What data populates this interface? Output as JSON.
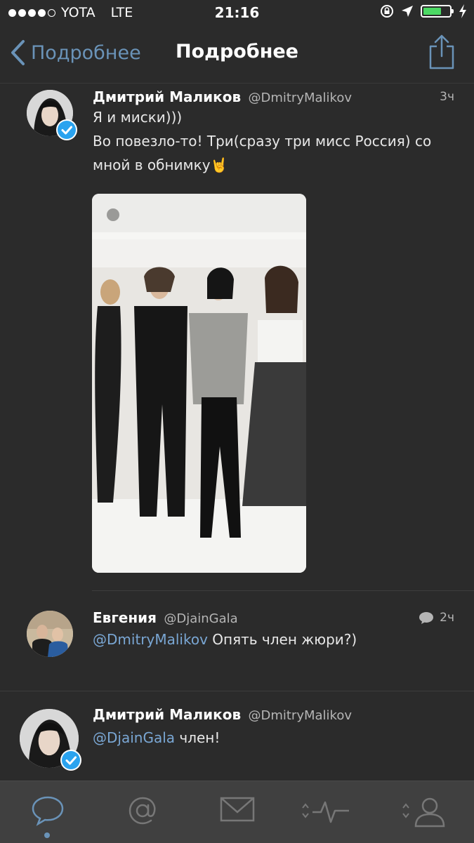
{
  "status_bar": {
    "carrier": "YOTA",
    "network": "LTE",
    "time": "21:16",
    "signal_bars": 4,
    "battery_level": 0.7
  },
  "nav": {
    "back_label": "Подробнее",
    "title": "Подробнее",
    "share_icon": "share-icon",
    "accent_color": "#6a93b8"
  },
  "tweets": [
    {
      "name": "Дмитрий Маликов",
      "handle": "@DmitryMalikov",
      "time": "3ч",
      "line1": "Я и миски)))",
      "line2": "Во повезло-то! Три(сразу три мисс Россия) со",
      "line3": "мной в обнимку🤘",
      "verified": true
    },
    {
      "name": "Евгения",
      "handle": "@DjainGala",
      "time": "2ч",
      "mention": "@DmitryMalikov",
      "text": " Опять член жюри?)",
      "has_reply_icon": true
    },
    {
      "name": "Дмитрий Маликов",
      "handle": "@DmitryMalikov",
      "mention": "@DjainGala",
      "text": " член!",
      "verified": true
    }
  ],
  "tab_bar": {
    "tabs": [
      "timeline-icon",
      "mentions-icon",
      "messages-icon",
      "activity-icon",
      "profile-icon"
    ],
    "active": 0
  }
}
